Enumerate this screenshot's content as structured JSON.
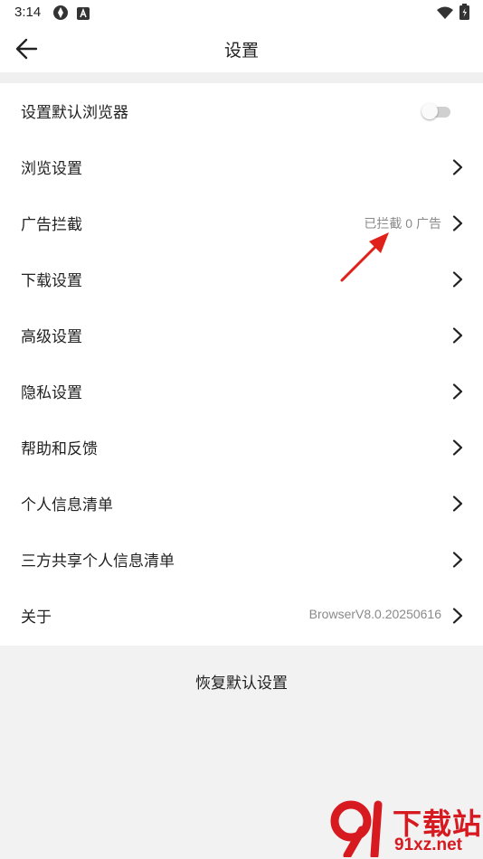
{
  "status_bar": {
    "time": "3:14"
  },
  "app_bar": {
    "title": "设置"
  },
  "settings": {
    "default_browser": {
      "label": "设置默认浏览器",
      "enabled": false
    },
    "browse": {
      "label": "浏览设置"
    },
    "ad_block": {
      "label": "广告拦截",
      "value": "已拦截 0 广告"
    },
    "download": {
      "label": "下载设置"
    },
    "advanced": {
      "label": "高级设置"
    },
    "privacy": {
      "label": "隐私设置"
    },
    "help": {
      "label": "帮助和反馈"
    },
    "personal_info": {
      "label": "个人信息清单"
    },
    "third_party": {
      "label": "三方共享个人信息清单"
    },
    "about": {
      "label": "关于",
      "value": "BrowserV8.0.20250616"
    }
  },
  "restore": {
    "label": "恢复默认设置"
  },
  "watermark": {
    "name": "下载站",
    "domain": "91xz.net"
  },
  "colors": {
    "annotation": "#e0201a",
    "watermark": "#d71920"
  }
}
